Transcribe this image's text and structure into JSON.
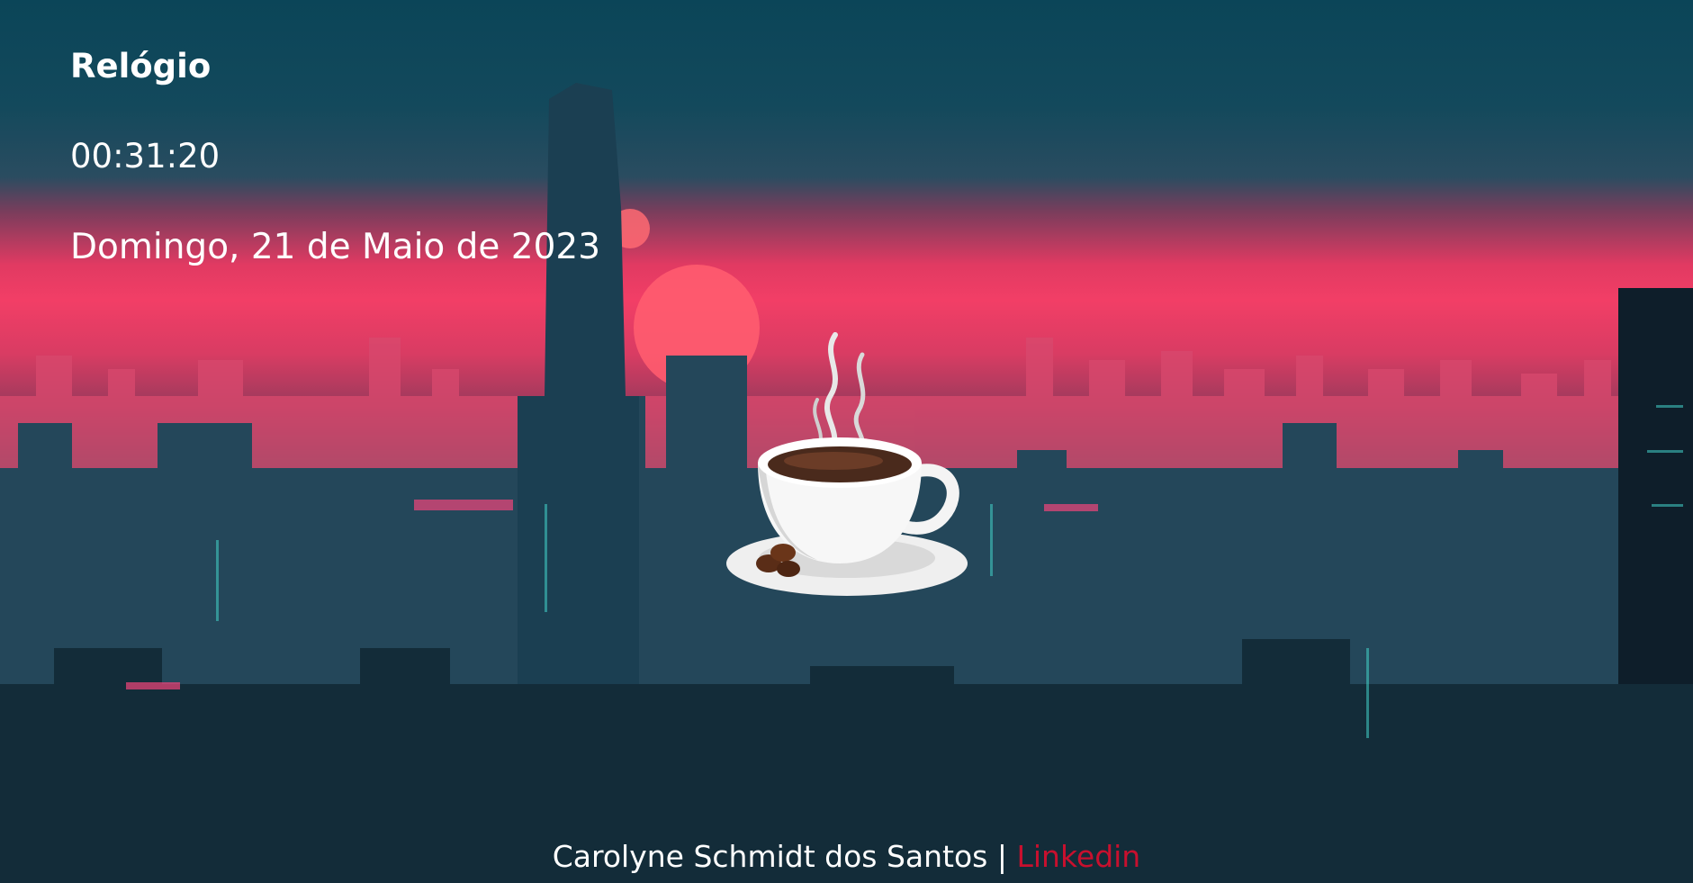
{
  "clock": {
    "title": "Relógio",
    "time": "00:31:20",
    "date": "Domingo, 21 de Maio de 2023"
  },
  "footer": {
    "author": "Carolyne Schmidt dos Santos",
    "separator": " | ",
    "link_label": "Linkedin"
  },
  "colors": {
    "text": "#ffffff",
    "link": "#c8102e",
    "sky_top": "#0b4558",
    "horizon_pink": "#f23e66",
    "city_dark": "#142f3d"
  },
  "icons": {
    "illustration": "coffee-cup-icon"
  }
}
